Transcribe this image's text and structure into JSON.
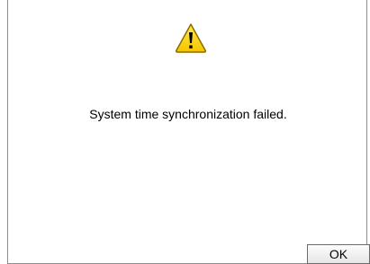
{
  "dialog": {
    "icon": "warning-icon",
    "message": "System time synchronization failed.",
    "ok_label": "OK"
  },
  "colors": {
    "warning_fill": "#ffd800",
    "warning_stroke": "#8a6d00",
    "border": "#8c8c8c"
  }
}
